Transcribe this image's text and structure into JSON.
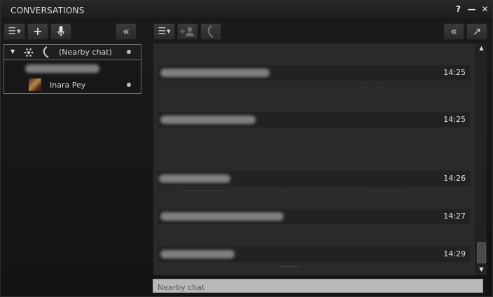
{
  "window": {
    "title": "CONVERSATIONS",
    "help_label": "?",
    "minimize_label": "—",
    "close_label": "✕"
  },
  "left_toolbar": {
    "options_icon": "☰",
    "add_icon": "+",
    "mic_icon": "microphone-icon",
    "collapse_icon": "«"
  },
  "right_toolbar": {
    "options_icon": "☰",
    "add_participant_icon": "add-person-icon",
    "call_icon": "phone-icon",
    "collapse_icon": "«",
    "tear_off_icon": "↗"
  },
  "conversations": {
    "group_label": "(Nearby chat)",
    "members": [
      {
        "name": ""
      },
      {
        "name": "Inara Pey"
      }
    ]
  },
  "messages": [
    {
      "time": "14:25"
    },
    {
      "time": "14:25"
    },
    {
      "time": "14:26"
    },
    {
      "time": "14:27"
    },
    {
      "time": "14:29"
    }
  ],
  "chat_input": {
    "placeholder": "Nearby chat",
    "value": ""
  },
  "colors": {
    "background": "#161616",
    "panel": "#2a2a2a",
    "input": "#b8b8b8"
  }
}
